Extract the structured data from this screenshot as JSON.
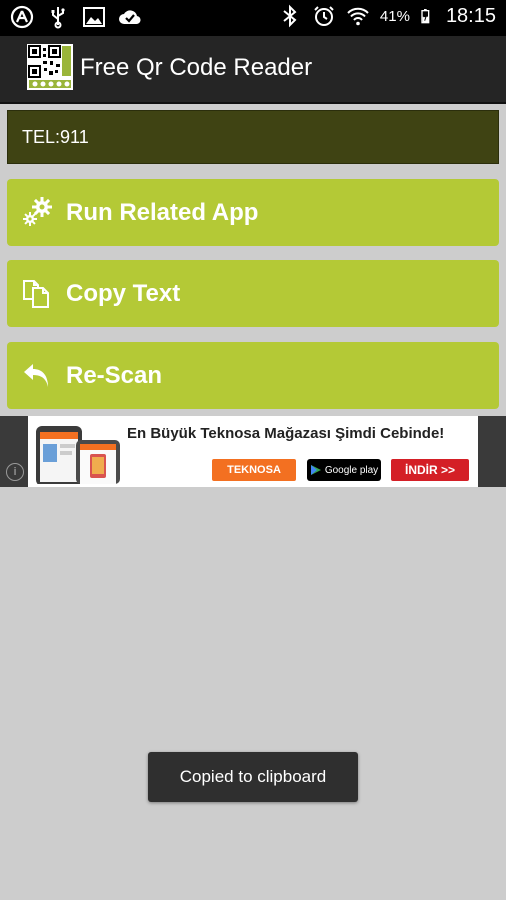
{
  "status_bar": {
    "battery": "41%",
    "time": "18:15",
    "left_icons": [
      "accessibility-icon",
      "usb-icon",
      "image-icon",
      "sync-check-icon"
    ],
    "right_icons": [
      "bluetooth-icon",
      "alarm-icon",
      "wifi-icon",
      "battery-icon"
    ]
  },
  "app_bar": {
    "title": "Free Qr Code Reader",
    "icon": "qr-code-icon"
  },
  "result": {
    "text": "TEL:911"
  },
  "buttons": {
    "run": {
      "label": "Run Related App",
      "icon": "gears-icon"
    },
    "copy": {
      "label": "Copy Text",
      "icon": "copy-icon"
    },
    "rescan": {
      "label": "Re-Scan",
      "icon": "reply-arrow-icon"
    }
  },
  "ad": {
    "headline": "En Büyük Teknosa Mağazası Şimdi Cebinde!",
    "brand": "TEKNOSA",
    "store_badge": "Google play",
    "cta": "İNDİR >>",
    "info_symbol": "i"
  },
  "toast": {
    "text": "Copied to clipboard"
  },
  "colors": {
    "button_green": "#b4c936",
    "result_bg": "#3f4313",
    "action_bar": "#252525",
    "background": "#cdcdcd"
  }
}
